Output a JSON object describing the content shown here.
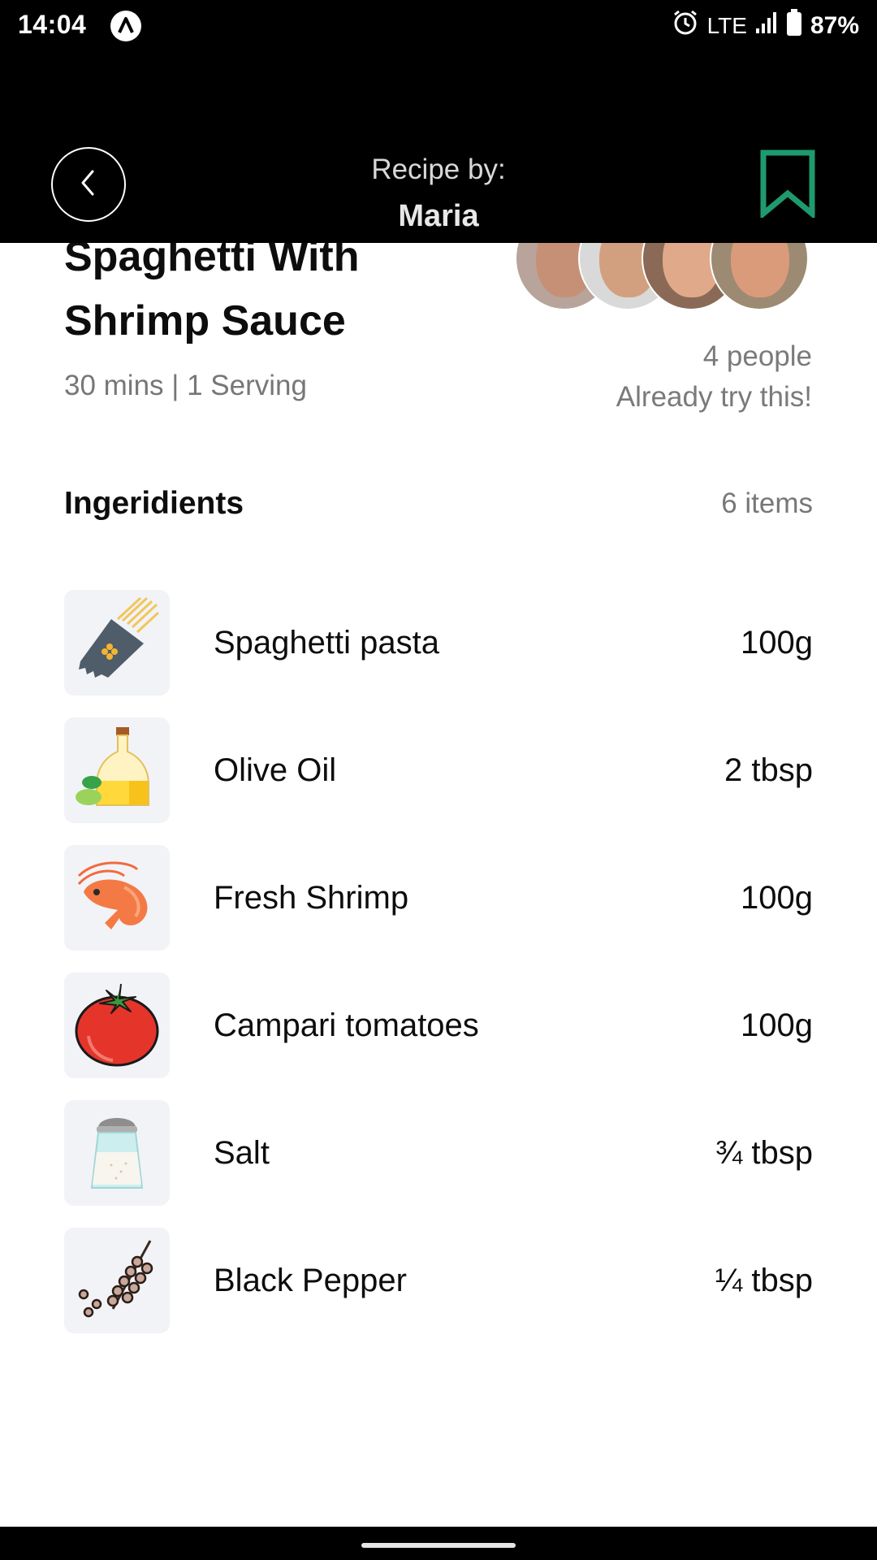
{
  "status_bar": {
    "time": "14:04",
    "network": "LTE",
    "battery": "87%",
    "icons": [
      "app-notification-icon",
      "alarm-icon",
      "signal-icon",
      "battery-icon"
    ]
  },
  "header": {
    "label": "Recipe by:",
    "author": "Maria",
    "back_icon": "chevron-left-icon",
    "bookmark_icon": "bookmark-icon",
    "bookmark_color": "#1f9a6e"
  },
  "recipe": {
    "title": "Spaghetti With Shrimp Sauce",
    "meta": "30 mins | 1 Serving",
    "tried_count": "4 people",
    "tried_text": "Already try this!"
  },
  "ingredients_section": {
    "title": "Ingeridients",
    "count": "6 items",
    "items": [
      {
        "name": "Spaghetti pasta",
        "qty": "100g",
        "icon": "spaghetti-icon"
      },
      {
        "name": "Olive Oil",
        "qty": "2 tbsp",
        "icon": "olive-oil-icon"
      },
      {
        "name": "Fresh Shrimp",
        "qty": "100g",
        "icon": "shrimp-icon"
      },
      {
        "name": "Campari tomatoes",
        "qty": "100g",
        "icon": "tomato-icon"
      },
      {
        "name": "Salt",
        "qty": "¾ tbsp",
        "icon": "salt-shaker-icon"
      },
      {
        "name": "Black Pepper",
        "qty": "¼ tbsp",
        "icon": "black-pepper-icon"
      }
    ]
  }
}
